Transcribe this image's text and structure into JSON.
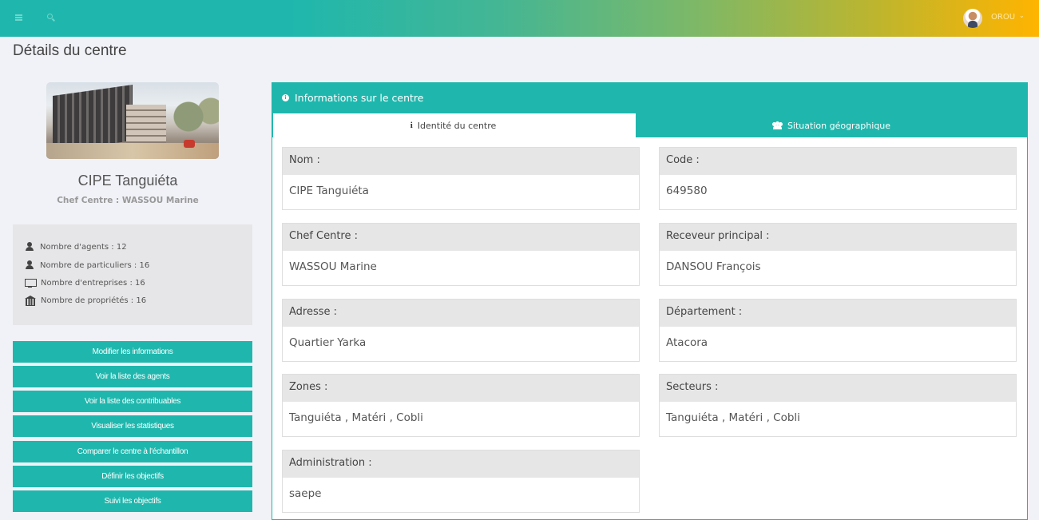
{
  "topbar": {
    "menu_icon": "bars-icon",
    "search_icon": "search-icon",
    "user_name": "OROU",
    "user_caret": "⌄",
    "gradient": [
      "#1fb7ad",
      "#ffb400"
    ]
  },
  "page": {
    "title": "Détails du centre"
  },
  "center": {
    "name": "CIPE Tanguiéta",
    "chef_line": "Chef Centre : WASSOU Marine"
  },
  "stats": [
    {
      "icon": "user-icon",
      "label": "Nombre d'agents : 12"
    },
    {
      "icon": "user-icon",
      "label": "Nombre de particuliers : 16"
    },
    {
      "icon": "desktop-icon",
      "label": "Nombre d'entreprises : 16"
    },
    {
      "icon": "bank-icon",
      "label": "Nombre de propriétés : 16"
    }
  ],
  "actions": [
    "Modifier les informations",
    "Voir la liste des agents",
    "Voir la liste des contribuables",
    "Visualiser les statistiques",
    "Comparer le centre à l'échantillon",
    "Définir les objectifs",
    "Suivi les objectifs"
  ],
  "panel": {
    "title": "Informations sur le centre",
    "tabs": [
      {
        "label": "Identité du centre",
        "icon": "info-icon"
      },
      {
        "label": "Situation géographique",
        "icon": "users-icon"
      }
    ]
  },
  "fields": {
    "nom": {
      "label": "Nom :",
      "value": "CIPE Tanguiéta"
    },
    "code": {
      "label": "Code :",
      "value": "649580"
    },
    "chef": {
      "label": "Chef Centre :",
      "value": "WASSOU Marine"
    },
    "receveur": {
      "label": "Receveur principal :",
      "value": "DANSOU François"
    },
    "adresse": {
      "label": "Adresse :",
      "value": "Quartier Yarka"
    },
    "departement": {
      "label": "Département :",
      "value": "Atacora"
    },
    "zones": {
      "label": "Zones :",
      "value": "Tanguiéta , Matéri , Cobli"
    },
    "secteurs": {
      "label": "Secteurs :",
      "value": "Tanguiéta , Matéri , Cobli"
    },
    "administration": {
      "label": "Administration :",
      "value": "saepe"
    }
  },
  "colors": {
    "accent": "#1fb7ad",
    "background": "#f1f2f7",
    "label_bg": "#e6e6e6"
  }
}
